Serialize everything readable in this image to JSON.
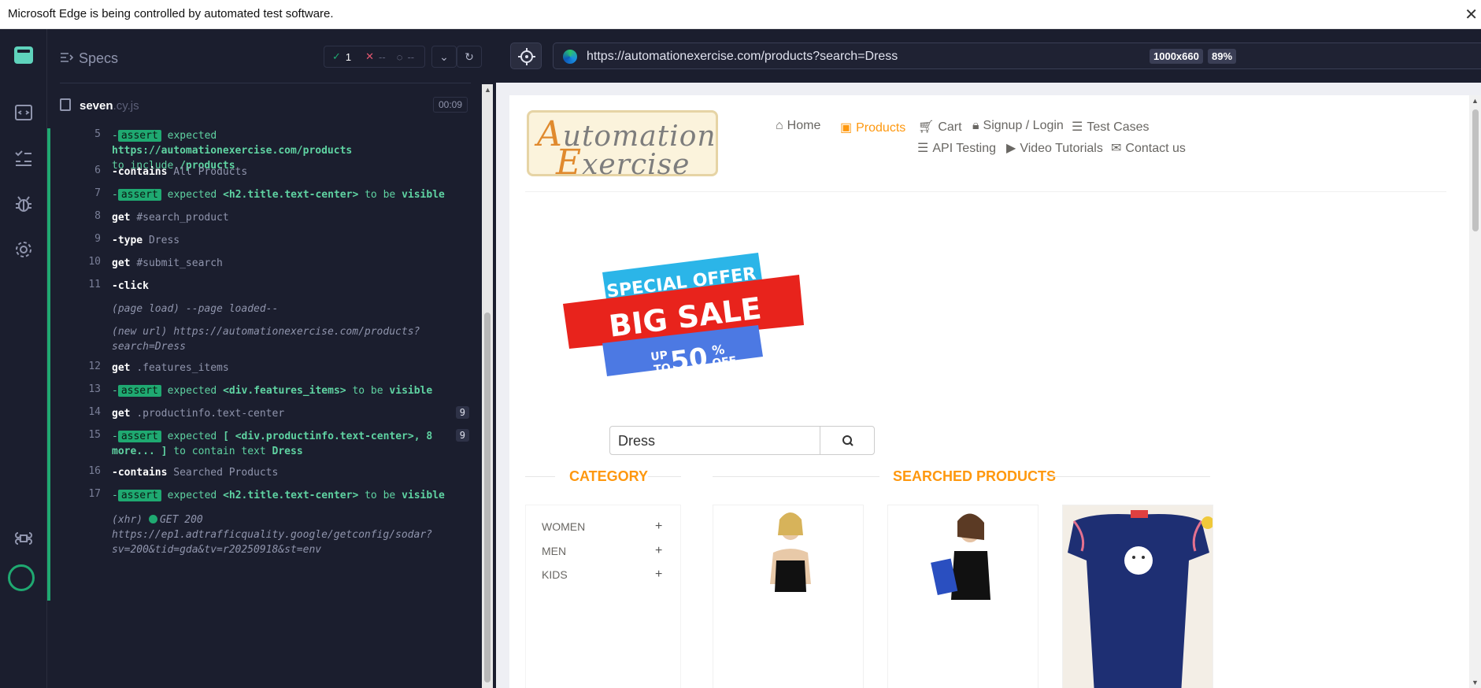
{
  "banner": {
    "message": "Microsoft Edge is being controlled by automated test software.",
    "close": "✕"
  },
  "reporter": {
    "specs_label": "Specs",
    "stats": {
      "passed": "1",
      "failed": "--",
      "pending": "--"
    },
    "spec": {
      "name": "seven",
      "ext": ".cy.js",
      "duration": "00:09"
    },
    "commands": [
      {
        "num": "5",
        "type": "assert",
        "text1": "expected",
        "val1": "https://automationexercise.com/products",
        "text2": "to include",
        "val2": "/products"
      },
      {
        "num": "6",
        "name": "contains",
        "arg": "All Products"
      },
      {
        "num": "7",
        "type": "assert",
        "text1": "expected",
        "val1": "<h2.title.text-center>",
        "text2": "to be",
        "val2": "visible"
      },
      {
        "num": "8",
        "name": "get",
        "arg": "#search_product"
      },
      {
        "num": "9",
        "name": "type",
        "arg": "Dress"
      },
      {
        "num": "10",
        "name": "get",
        "arg": "#submit_search"
      },
      {
        "num": "11",
        "name": "click",
        "arg": ""
      },
      {
        "label": "(page load)",
        "arg": "--page loaded--"
      },
      {
        "label": "(new url)",
        "arg": "https://automationexercise.com/products?",
        "arg2": "search=Dress"
      },
      {
        "num": "12",
        "name": "get",
        "arg": ".features_items"
      },
      {
        "num": "13",
        "type": "assert",
        "text1": "expected",
        "val1": "<div.features_items>",
        "text2": "to be",
        "val2": "visible"
      },
      {
        "num": "14",
        "name": "get",
        "arg": ".productinfo.text-center",
        "count": "9"
      },
      {
        "num": "15",
        "type": "assert",
        "text1": "expected",
        "val1": "[ <div.productinfo.text-center>, 8",
        "val1b": "more... ]",
        "text2": "to contain text",
        "val2": "Dress",
        "count": "9"
      },
      {
        "num": "16",
        "name": "contains",
        "arg": "Searched Products"
      },
      {
        "num": "17",
        "type": "assert",
        "text1": "expected",
        "val1": "<h2.title.text-center>",
        "text2": "to be",
        "val2": "visible"
      },
      {
        "label": "(xhr)",
        "method": "GET 200",
        "arg": "https://ep1.adtrafficquality.google/getconfig/sodar?",
        "arg2": "sv=200&tid=gda&tv=r20250918&st=env"
      }
    ],
    "assert_badge": "assert"
  },
  "aut": {
    "url": "https://automationexercise.com/products?search=Dress",
    "viewport": "1000x660",
    "zoom": "89%"
  },
  "site": {
    "logo": {
      "line1": "Automation",
      "line2": "Exercise"
    },
    "nav": [
      "Home",
      "Products",
      "Cart",
      "Signup / Login",
      "Test Cases",
      "API Testing",
      "Video Tutorials",
      "Contact us"
    ],
    "sale": {
      "top": "SPECIAL OFFER",
      "mid": "BIG SALE",
      "up": "UP",
      "to": "TO",
      "pct": "50",
      "pctsym": "%",
      "off": "OFF"
    },
    "search_value": "Dress",
    "category_title": "CATEGORY",
    "searched_title": "SEARCHED PRODUCTS",
    "categories": [
      "WOMEN",
      "MEN",
      "KIDS"
    ],
    "plus": "+"
  },
  "colors": {
    "accent": "#fe980f",
    "cypress_green": "#1fa971",
    "panel_bg": "#1b1e2e"
  },
  "icons": [
    "home-icon",
    "products-icon",
    "cart-icon",
    "lock-icon",
    "list-icon",
    "youtube-icon",
    "envelope-icon",
    "search-icon",
    "selector-icon",
    "edge-icon"
  ]
}
